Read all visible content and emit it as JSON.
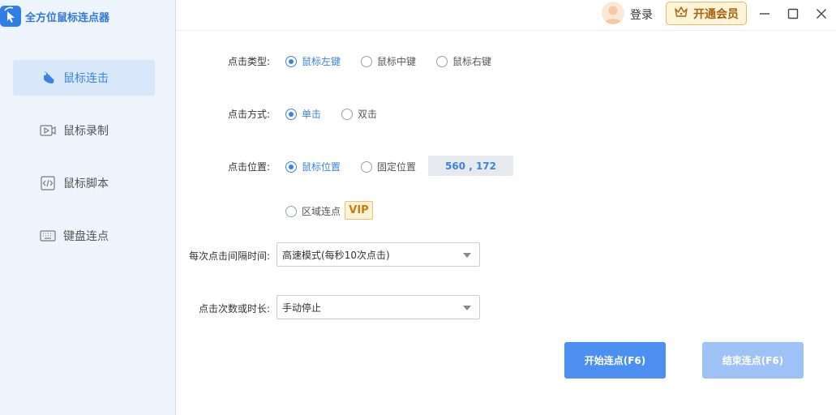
{
  "app": {
    "title": "全方位鼠标连点器"
  },
  "sidebar": {
    "items": [
      {
        "label": "鼠标连击",
        "icon": "mouse-icon",
        "active": true
      },
      {
        "label": "鼠标录制",
        "icon": "record-icon",
        "active": false
      },
      {
        "label": "鼠标脚本",
        "icon": "code-icon",
        "active": false
      },
      {
        "label": "键盘连点",
        "icon": "keyboard-icon",
        "active": false
      }
    ]
  },
  "header": {
    "login_label": "登录",
    "vip_label": "开通会员"
  },
  "form": {
    "click_type": {
      "label": "点击类型:",
      "options": [
        "鼠标左键",
        "鼠标中键",
        "鼠标右键"
      ],
      "selected": "鼠标左键"
    },
    "click_mode": {
      "label": "点击方式:",
      "options": [
        "单击",
        "双击"
      ],
      "selected": "单击"
    },
    "click_position": {
      "label": "点击位置:",
      "options": [
        "鼠标位置",
        "固定位置",
        "区域连点"
      ],
      "selected": "鼠标位置",
      "coords": "560 , 172",
      "vip_tag": "VIP"
    },
    "interval": {
      "label": "每次点击间隔时间:",
      "value": "高速模式(每秒10次点击)"
    },
    "count": {
      "label": "点击次数或时长:",
      "value": "手动停止"
    }
  },
  "actions": {
    "start_label": "开始连点(F6)",
    "stop_label": "结束连点(F6)"
  },
  "colors": {
    "accent": "#3c82e0",
    "vip": "#c77e10"
  }
}
